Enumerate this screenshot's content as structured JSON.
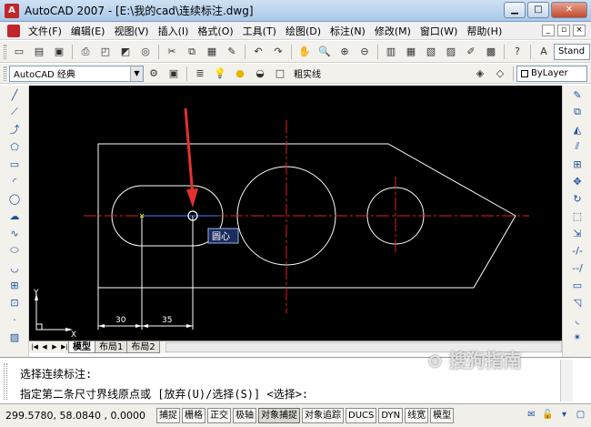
{
  "window": {
    "title": "AutoCAD 2007 - [E:\\我的cad\\连续标注.dwg]",
    "app_icon": "A"
  },
  "menu": {
    "items": [
      "文件(F)",
      "编辑(E)",
      "视图(V)",
      "插入(I)",
      "格式(O)",
      "工具(T)",
      "绘图(D)",
      "标注(N)",
      "修改(M)",
      "窗口(W)",
      "帮助(H)"
    ]
  },
  "toolbar": {
    "style_combo": "Stand",
    "workspace_combo": "AutoCAD 经典",
    "layer_combo": "粗实线",
    "bylayer_combo": "ByLayer"
  },
  "drawing": {
    "tooltip": "圆心",
    "dim_values": [
      "30",
      "35"
    ],
    "axis_labels": {
      "x": "X",
      "y": "Y"
    },
    "colors": {
      "geometry": "#ffffff",
      "centerline": "#e02020",
      "snap": "#3b83ff",
      "arrow": "#e53030"
    }
  },
  "tabs": {
    "items": [
      "模型",
      "布局1",
      "布局2"
    ],
    "active": "模型"
  },
  "command": {
    "line1": "选择连续标注:",
    "line2": "指定第二条尺寸界线原点或 [放弃(U)/选择(S)] <选择>:"
  },
  "status": {
    "coords": "299.5780, 58.0840 , 0.0000",
    "buttons": [
      {
        "label": "捕捉",
        "on": false
      },
      {
        "label": "栅格",
        "on": false
      },
      {
        "label": "正交",
        "on": false
      },
      {
        "label": "极轴",
        "on": false
      },
      {
        "label": "对象捕捉",
        "on": true
      },
      {
        "label": "对象追踪",
        "on": false
      },
      {
        "label": "DUCS",
        "on": false
      },
      {
        "label": "DYN",
        "on": false
      },
      {
        "label": "线宽",
        "on": false
      },
      {
        "label": "模型",
        "on": false
      }
    ]
  }
}
